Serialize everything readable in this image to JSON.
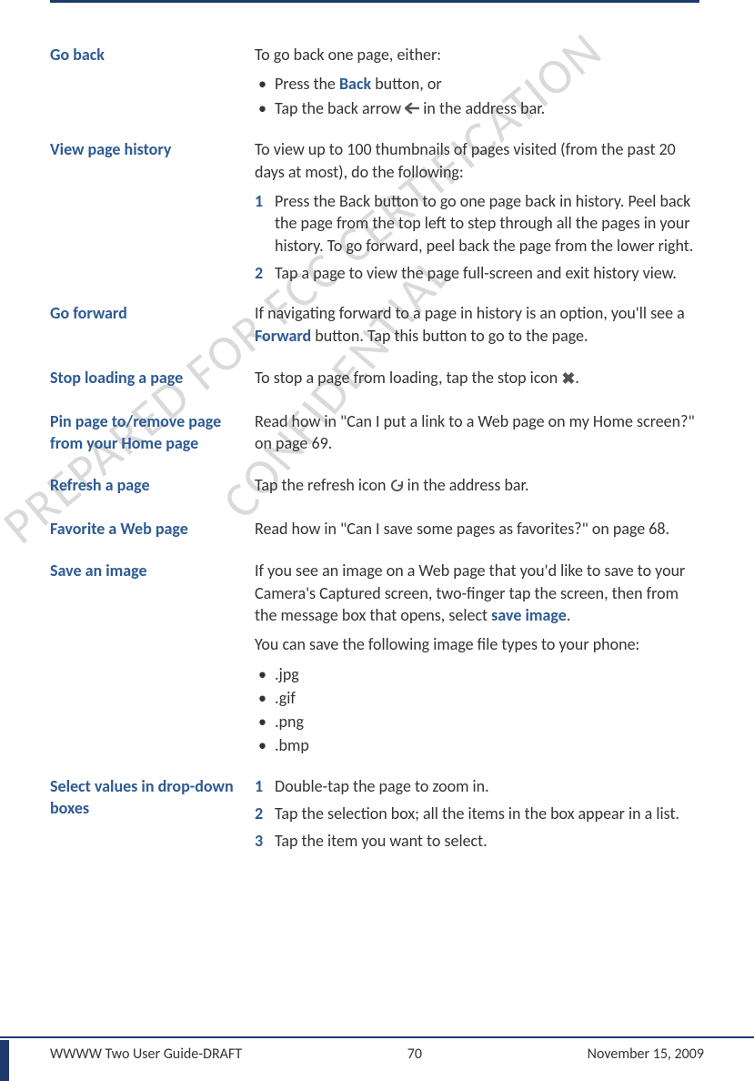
{
  "watermarks": {
    "wm1": "PREPARED FOR FCC CERTIFICATION",
    "wm2": "CONFIDENTIAL"
  },
  "sections": {
    "goback": {
      "label": "Go back",
      "intro": "To go back one page, either:",
      "b1a": "Press the ",
      "b1kw": "Back",
      "b1b": " button, or",
      "b2a": "Tap the back arrow ",
      "b2b": " in the address bar."
    },
    "history": {
      "label": "View page history",
      "intro": "To view up to 100 thumbnails of pages visited (from the past 20 days at most), do the following:",
      "s1": "Press the Back button to go one page back in history. Peel back the page from the top left to step through all the pages in your history. To go forward, peel back the page from the lower right.",
      "s2": "Tap a page to view the page full-screen and exit history view."
    },
    "forward": {
      "label": "Go forward",
      "t1": "If navigating forward to a page in history is an option, you'll see a ",
      "kw": "Forward",
      "t2": " button. Tap this button to go to the page."
    },
    "stop": {
      "label": "Stop loading a page",
      "t1": "To stop a page from loading, tap the stop icon ",
      "t2": "."
    },
    "pin": {
      "label": "Pin page to/remove page from your Home page",
      "text": "Read how in \"Can I put a link to a Web page on my Home screen?\" on page 69."
    },
    "refresh": {
      "label": "Refresh a page",
      "t1": "Tap the refresh icon ",
      "t2": " in the address bar."
    },
    "favorite": {
      "label": "Favorite a Web page",
      "text": "Read how in \"Can I save some pages as favorites?\" on page 68."
    },
    "saveimg": {
      "label": "Save an image",
      "p1a": "If you see an image on a Web page that you'd like to save to your Camera's Captured screen, two-finger tap the screen, then from the message box that opens, select ",
      "p1kw": "save image",
      "p1b": ".",
      "p2": "You can save the following image file types to your phone:",
      "f1": ".jpg",
      "f2": ".gif",
      "f3": ".png",
      "f4": ".bmp"
    },
    "dropdown": {
      "label": "Select values in drop-down boxes",
      "s1": "Double-tap the page to zoom in.",
      "s2": "Tap the selection box; all the items in the box appear in a list.",
      "s3": "Tap the item you want to select."
    }
  },
  "footer": {
    "left": "WWWW Two User Guide-DRAFT",
    "center": "70",
    "right": "November 15, 2009"
  }
}
